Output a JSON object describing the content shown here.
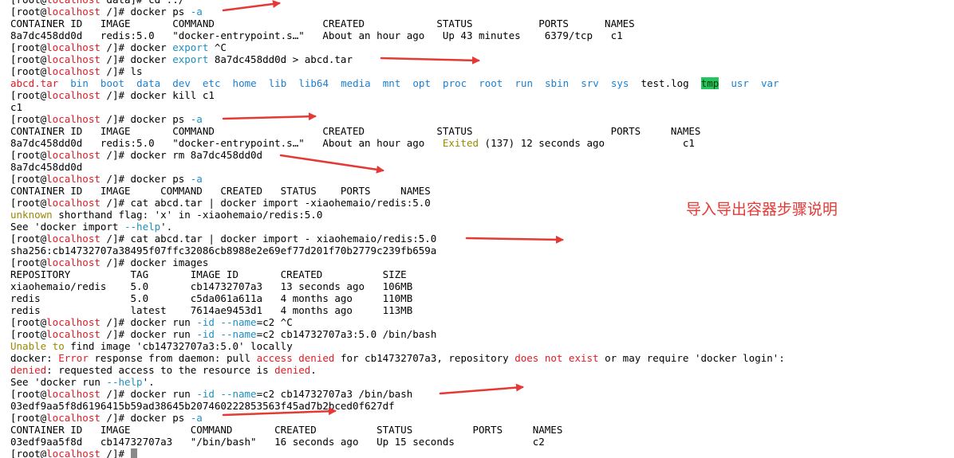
{
  "terminal": {
    "lines": [
      [
        {
          "t": "[root@"
        },
        {
          "t": "localhost",
          "c": "red"
        },
        {
          "t": " data]# cd ../"
        }
      ],
      [
        {
          "t": "[root@"
        },
        {
          "t": "localhost",
          "c": "red"
        },
        {
          "t": " /]# docker ps "
        },
        {
          "t": "-a",
          "c": "cyan"
        }
      ],
      [
        {
          "t": "CONTAINER ID   IMAGE       COMMAND                  CREATED            STATUS           PORTS      NAMES"
        }
      ],
      [
        {
          "t": "8a7dc458dd0d   redis:5.0   \"docker-entrypoint.s…\"   About an hour ago   Up 43 minutes    6379/tcp   c1"
        }
      ],
      [
        {
          "t": "[root@"
        },
        {
          "t": "localhost",
          "c": "red"
        },
        {
          "t": " /]# docker "
        },
        {
          "t": "export",
          "c": "cyan"
        },
        {
          "t": " ^C"
        }
      ],
      [
        {
          "t": "[root@"
        },
        {
          "t": "localhost",
          "c": "red"
        },
        {
          "t": " /]# docker "
        },
        {
          "t": "export",
          "c": "cyan"
        },
        {
          "t": " 8a7dc458dd0d > abcd.tar"
        }
      ],
      [
        {
          "t": "[root@"
        },
        {
          "t": "localhost",
          "c": "red"
        },
        {
          "t": " /]# ls"
        }
      ],
      [
        {
          "t": "abcd.tar",
          "c": "red"
        },
        {
          "t": "  "
        },
        {
          "t": "bin",
          "c": "cyanblue"
        },
        {
          "t": "  "
        },
        {
          "t": "boot",
          "c": "cyanblue"
        },
        {
          "t": "  "
        },
        {
          "t": "data",
          "c": "cyanblue"
        },
        {
          "t": "  "
        },
        {
          "t": "dev",
          "c": "cyanblue"
        },
        {
          "t": "  "
        },
        {
          "t": "etc",
          "c": "cyanblue"
        },
        {
          "t": "  "
        },
        {
          "t": "home",
          "c": "cyanblue"
        },
        {
          "t": "  "
        },
        {
          "t": "lib",
          "c": "cyanblue"
        },
        {
          "t": "  "
        },
        {
          "t": "lib64",
          "c": "cyanblue"
        },
        {
          "t": "  "
        },
        {
          "t": "media",
          "c": "cyanblue"
        },
        {
          "t": "  "
        },
        {
          "t": "mnt",
          "c": "cyanblue"
        },
        {
          "t": "  "
        },
        {
          "t": "opt",
          "c": "cyanblue"
        },
        {
          "t": "  "
        },
        {
          "t": "proc",
          "c": "cyanblue"
        },
        {
          "t": "  "
        },
        {
          "t": "root",
          "c": "cyanblue"
        },
        {
          "t": "  "
        },
        {
          "t": "run",
          "c": "cyanblue"
        },
        {
          "t": "  "
        },
        {
          "t": "sbin",
          "c": "cyanblue"
        },
        {
          "t": "  "
        },
        {
          "t": "srv",
          "c": "cyanblue"
        },
        {
          "t": "  "
        },
        {
          "t": "sys",
          "c": "cyanblue"
        },
        {
          "t": "  test.log  "
        },
        {
          "t": "tmp",
          "c": "hl"
        },
        {
          "t": "  "
        },
        {
          "t": "usr",
          "c": "cyanblue"
        },
        {
          "t": "  "
        },
        {
          "t": "var",
          "c": "cyanblue"
        }
      ],
      [
        {
          "t": "[root@"
        },
        {
          "t": "localhost",
          "c": "red"
        },
        {
          "t": " /]# docker kill c1"
        }
      ],
      [
        {
          "t": "c1"
        }
      ],
      [
        {
          "t": "[root@"
        },
        {
          "t": "localhost",
          "c": "red"
        },
        {
          "t": " /]# docker ps "
        },
        {
          "t": "-a",
          "c": "cyan"
        }
      ],
      [
        {
          "t": "CONTAINER ID   IMAGE       COMMAND                  CREATED            STATUS                       PORTS     NAMES"
        }
      ],
      [
        {
          "t": "8a7dc458dd0d   redis:5.0   \"docker-entrypoint.s…\"   About an hour ago   "
        },
        {
          "t": "Exited",
          "c": "olive"
        },
        {
          "t": " (137) 12 seconds ago             c1"
        }
      ],
      [
        {
          "t": "[root@"
        },
        {
          "t": "localhost",
          "c": "red"
        },
        {
          "t": " /]# docker rm 8a7dc458dd0d"
        }
      ],
      [
        {
          "t": "8a7dc458dd0d"
        }
      ],
      [
        {
          "t": "[root@"
        },
        {
          "t": "localhost",
          "c": "red"
        },
        {
          "t": " /]# docker ps "
        },
        {
          "t": "-a",
          "c": "cyan"
        }
      ],
      [
        {
          "t": "CONTAINER ID   IMAGE     COMMAND   CREATED   STATUS    PORTS     NAMES"
        }
      ],
      [
        {
          "t": "[root@"
        },
        {
          "t": "localhost",
          "c": "red"
        },
        {
          "t": " /]# cat abcd.tar | docker import -xiaohemaio/redis:5.0"
        }
      ],
      [
        {
          "t": "unknown",
          "c": "olive"
        },
        {
          "t": " shorthand flag: 'x' in -xiaohemaio/redis:5.0"
        }
      ],
      [
        {
          "t": "See 'docker import "
        },
        {
          "t": "--help",
          "c": "cyan"
        },
        {
          "t": "'."
        }
      ],
      [
        {
          "t": "[root@"
        },
        {
          "t": "localhost",
          "c": "red"
        },
        {
          "t": " /]# cat abcd.tar | docker import - xiaohemaio/redis:5.0"
        }
      ],
      [
        {
          "t": "sha256:cb14732707a38495f07ffc32086cb8988e2e69ef77d201f70b2779c239fb659a"
        }
      ],
      [
        {
          "t": "[root@"
        },
        {
          "t": "localhost",
          "c": "red"
        },
        {
          "t": " /]# docker images"
        }
      ],
      [
        {
          "t": "REPOSITORY          TAG       IMAGE ID       CREATED          SIZE"
        }
      ],
      [
        {
          "t": "xiaohemaio/redis    5.0       cb14732707a3   13 seconds ago   106MB"
        }
      ],
      [
        {
          "t": "redis               5.0       c5da061a611a   4 months ago     110MB"
        }
      ],
      [
        {
          "t": "redis               latest    7614ae9453d1   4 months ago     113MB"
        }
      ],
      [
        {
          "t": "[root@"
        },
        {
          "t": "localhost",
          "c": "red"
        },
        {
          "t": " /]# docker run "
        },
        {
          "t": "-id",
          "c": "cyan"
        },
        {
          "t": " "
        },
        {
          "t": "--name",
          "c": "cyan"
        },
        {
          "t": "=c2 ^C"
        }
      ],
      [
        {
          "t": "[root@"
        },
        {
          "t": "localhost",
          "c": "red"
        },
        {
          "t": " /]# docker run "
        },
        {
          "t": "-id",
          "c": "cyan"
        },
        {
          "t": " "
        },
        {
          "t": "--name",
          "c": "cyan"
        },
        {
          "t": "=c2 cb14732707a3:5.0 /bin/bash"
        }
      ],
      [
        {
          "t": "Unable",
          "c": "olive"
        },
        {
          "t": " "
        },
        {
          "t": "to",
          "c": "olive"
        },
        {
          "t": " find image 'cb14732707a3:5.0' locally"
        }
      ],
      [
        {
          "t": "docker: "
        },
        {
          "t": "Error",
          "c": "red"
        },
        {
          "t": " response from daemon: pull "
        },
        {
          "t": "access denied",
          "c": "red"
        },
        {
          "t": " for cb14732707a3, repository "
        },
        {
          "t": "does not exist",
          "c": "red"
        },
        {
          "t": " or may require 'docker login':"
        }
      ],
      [
        {
          "t": "denied",
          "c": "red"
        },
        {
          "t": ": requested access to the resource is "
        },
        {
          "t": "denied",
          "c": "red"
        },
        {
          "t": "."
        }
      ],
      [
        {
          "t": "See 'docker run "
        },
        {
          "t": "--help",
          "c": "cyan"
        },
        {
          "t": "'."
        }
      ],
      [
        {
          "t": "[root@"
        },
        {
          "t": "localhost",
          "c": "red"
        },
        {
          "t": " /]# docker run "
        },
        {
          "t": "-id",
          "c": "cyan"
        },
        {
          "t": " "
        },
        {
          "t": "--name",
          "c": "cyan"
        },
        {
          "t": "=c2 cb14732707a3 /bin/bash"
        }
      ],
      [
        {
          "t": "03edf9aa5f8d6196415b59ad38645b207460222853563f45ad7b2bced0f627df"
        }
      ],
      [
        {
          "t": "[root@"
        },
        {
          "t": "localhost",
          "c": "red"
        },
        {
          "t": " /]# docker ps "
        },
        {
          "t": "-a",
          "c": "cyan"
        }
      ],
      [
        {
          "t": "CONTAINER ID   IMAGE          COMMAND       CREATED          STATUS          PORTS     NAMES"
        }
      ],
      [
        {
          "t": "03edf9aa5f8d   cb14732707a3   \"/bin/bash\"   16 seconds ago   Up 15 seconds             c2"
        }
      ],
      [
        {
          "t": "[root@"
        },
        {
          "t": "localhost",
          "c": "red"
        },
        {
          "t": " /]# "
        },
        {
          "t": "",
          "cursor": true
        }
      ]
    ]
  },
  "annotation": {
    "text": "导入导出容器步骤说明"
  },
  "colors": {
    "arrow": "#e53935",
    "host": "#e01b24",
    "flag": "#1f8fbf",
    "dir": "#1a7fd0",
    "warn": "#9a8a00",
    "tmp_highlight": "#22c55e"
  }
}
